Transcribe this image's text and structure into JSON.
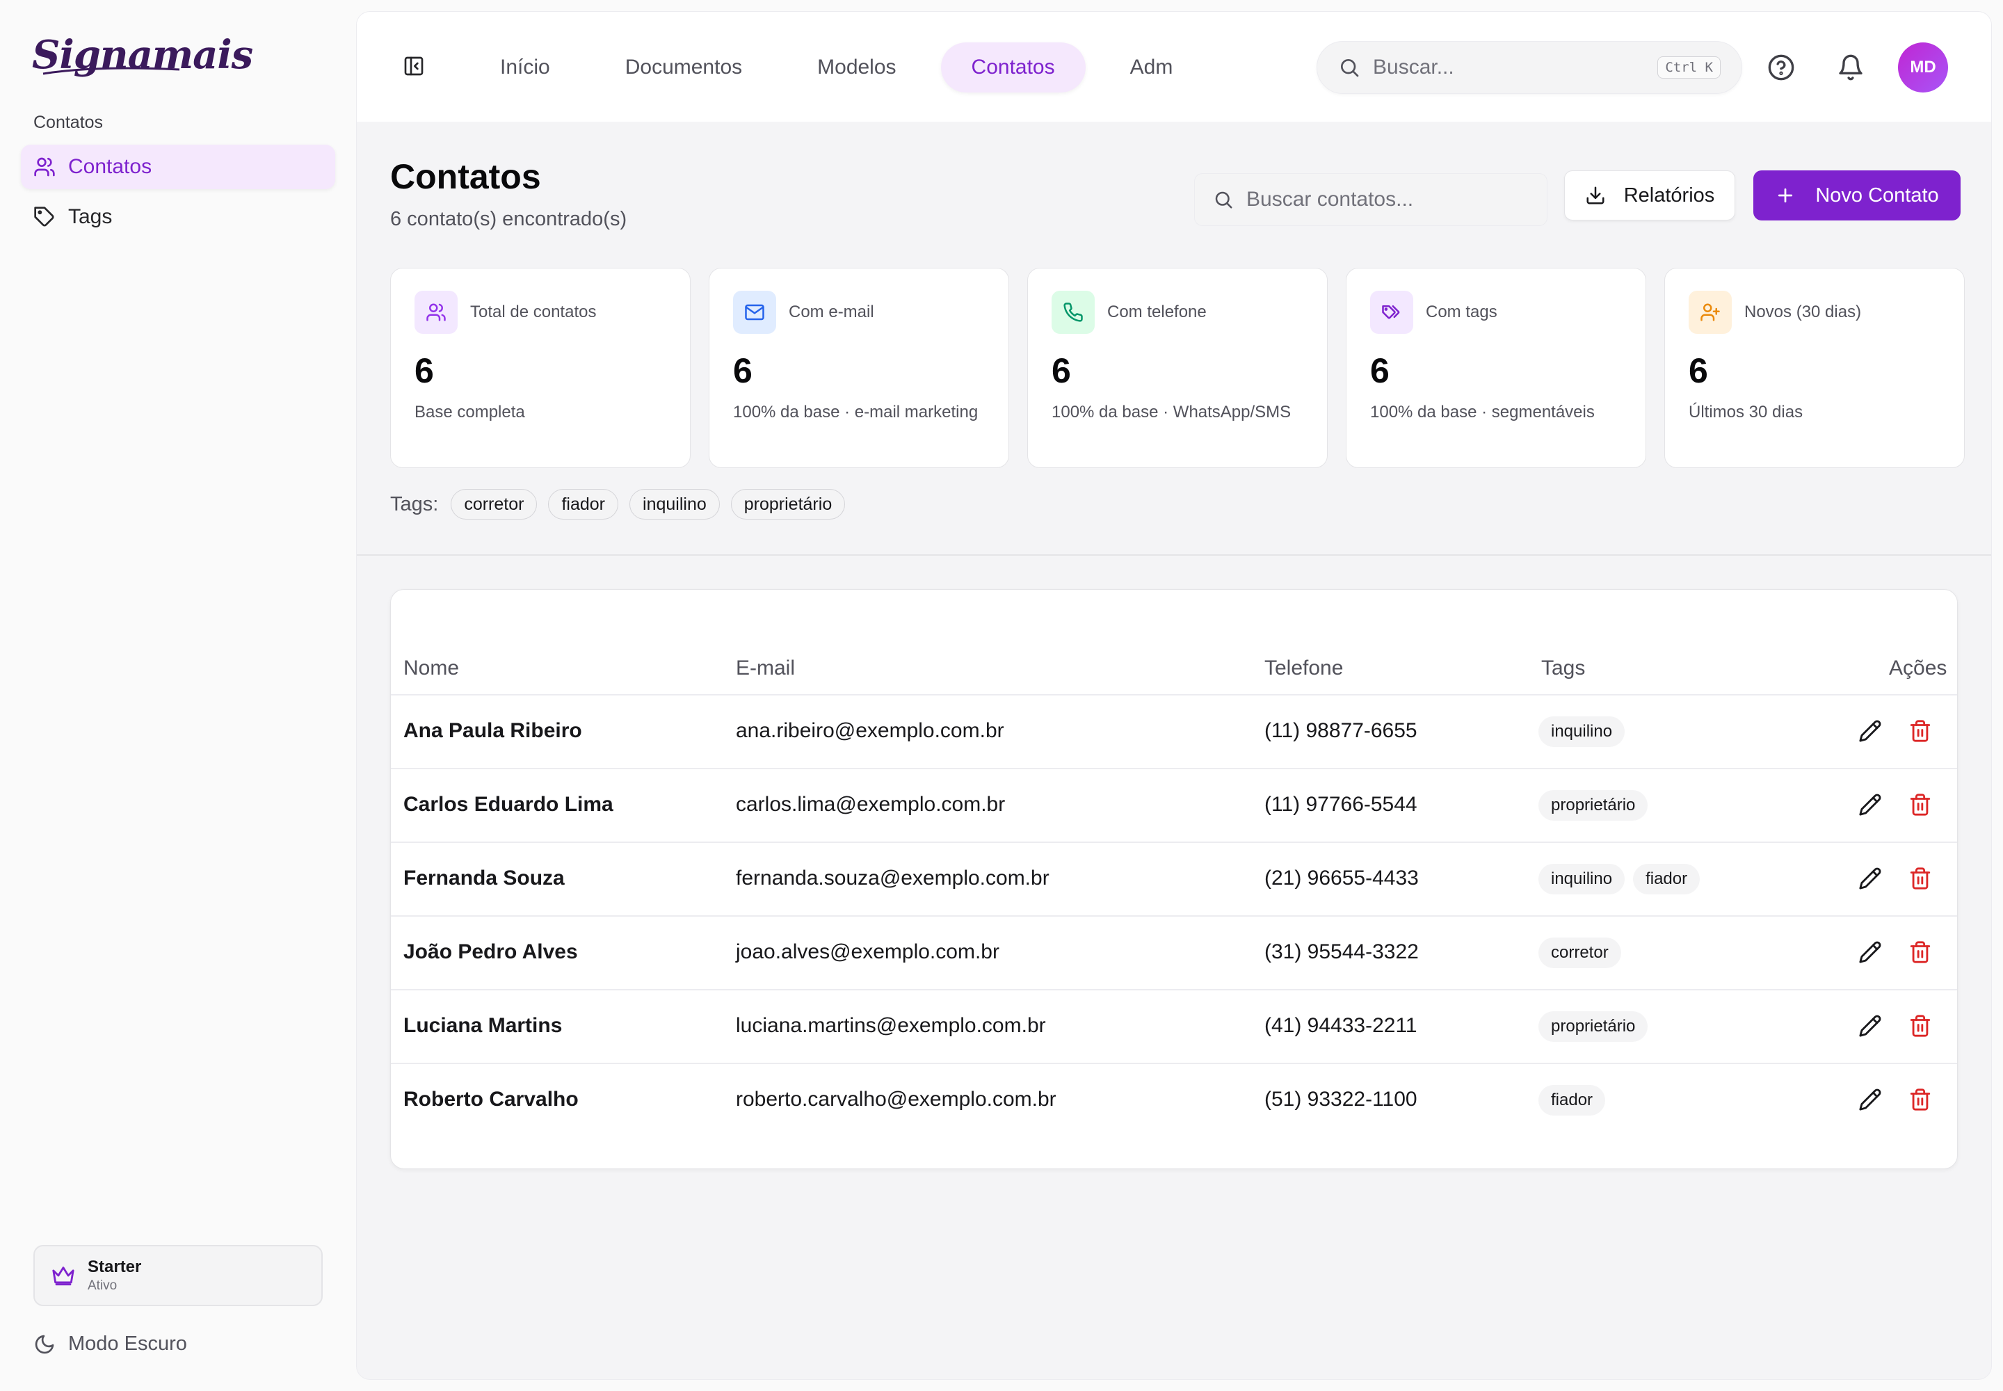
{
  "sidebar": {
    "logo": "Signamais",
    "section_label": "Contatos",
    "items": [
      {
        "label": "Contatos",
        "icon": "users-icon",
        "active": true
      },
      {
        "label": "Tags",
        "icon": "tag-icon",
        "active": false
      }
    ],
    "plan": {
      "name": "Starter",
      "status": "Ativo",
      "icon": "crown-icon"
    },
    "dark_mode_label": "Modo Escuro"
  },
  "topbar": {
    "nav": [
      {
        "label": "Início",
        "active": false
      },
      {
        "label": "Documentos",
        "active": false
      },
      {
        "label": "Modelos",
        "active": false
      },
      {
        "label": "Contatos",
        "active": true
      },
      {
        "label": "Adm",
        "active": false
      }
    ],
    "search_placeholder": "Buscar...",
    "search_shortcut": "Ctrl K",
    "avatar_initials": "MD"
  },
  "page": {
    "title": "Contatos",
    "subtitle": "6 contato(s) encontrado(s)",
    "search_placeholder": "Buscar contatos...",
    "reports_label": "Relatórios",
    "new_contact_label": "Novo Contato"
  },
  "stats": [
    {
      "label": "Total de contatos",
      "value": "6",
      "desc": "Base completa",
      "icon": "users-icon",
      "color": "#9333ea",
      "bg": "#f3e8ff"
    },
    {
      "label": "Com e-mail",
      "value": "6",
      "desc": "100% da base · e-mail marketing",
      "icon": "mail-icon",
      "color": "#2563eb",
      "bg": "#e0ecff"
    },
    {
      "label": "Com telefone",
      "value": "6",
      "desc": "100% da base · WhatsApp/SMS",
      "icon": "phone-icon",
      "color": "#059669",
      "bg": "#dcfce7"
    },
    {
      "label": "Com tags",
      "value": "6",
      "desc": "100% da base · segmentáveis",
      "icon": "tags-icon",
      "color": "#7e22ce",
      "bg": "#f3e8ff"
    },
    {
      "label": "Novos (30 dias)",
      "value": "6",
      "desc": "Últimos 30 dias",
      "icon": "user-plus-icon",
      "color": "#ea8a0c",
      "bg": "#fff1dc"
    }
  ],
  "tags_filter": {
    "label": "Tags:",
    "tags": [
      "corretor",
      "fiador",
      "inquilino",
      "proprietário"
    ]
  },
  "table": {
    "headers": {
      "name": "Nome",
      "email": "E-mail",
      "phone": "Telefone",
      "tags": "Tags",
      "actions": "Ações"
    },
    "rows": [
      {
        "name": "Ana Paula Ribeiro",
        "email": "ana.ribeiro@exemplo.com.br",
        "phone": "(11) 98877-6655",
        "tags": [
          "inquilino"
        ]
      },
      {
        "name": "Carlos Eduardo Lima",
        "email": "carlos.lima@exemplo.com.br",
        "phone": "(11) 97766-5544",
        "tags": [
          "proprietário"
        ]
      },
      {
        "name": "Fernanda Souza",
        "email": "fernanda.souza@exemplo.com.br",
        "phone": "(21) 96655-4433",
        "tags": [
          "inquilino",
          "fiador"
        ]
      },
      {
        "name": "João Pedro Alves",
        "email": "joao.alves@exemplo.com.br",
        "phone": "(31) 95544-3322",
        "tags": [
          "corretor"
        ]
      },
      {
        "name": "Luciana Martins",
        "email": "luciana.martins@exemplo.com.br",
        "phone": "(41) 94433-2211",
        "tags": [
          "proprietário"
        ]
      },
      {
        "name": "Roberto Carvalho",
        "email": "roberto.carvalho@exemplo.com.br",
        "phone": "(51) 93322-1100",
        "tags": [
          "fiador"
        ]
      }
    ]
  },
  "colors": {
    "accent": "#7e22ce",
    "danger": "#dc2626"
  }
}
